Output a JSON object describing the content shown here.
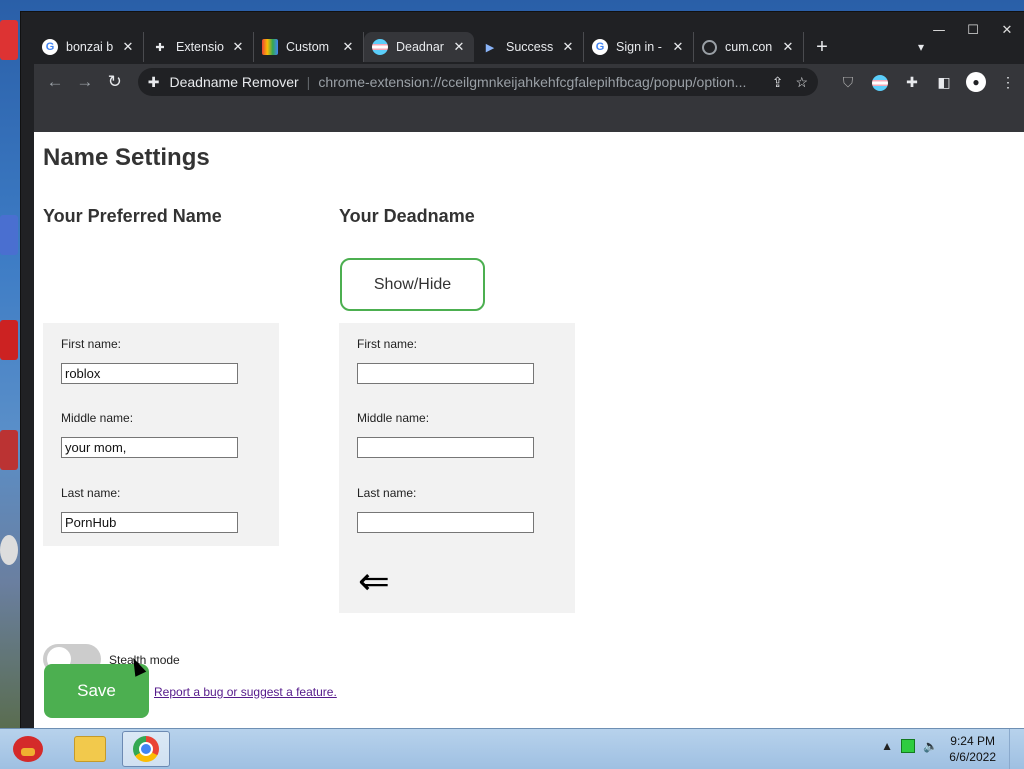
{
  "browser": {
    "tabs": [
      {
        "title": "bonzai b",
        "favicon": "google-icon",
        "active": false
      },
      {
        "title": "Extensio",
        "favicon": "puzzle-icon",
        "active": false
      },
      {
        "title": "Custom",
        "favicon": "store-icon",
        "active": false
      },
      {
        "title": "Deadnar",
        "favicon": "trans-flag-icon",
        "active": true
      },
      {
        "title": "Success",
        "favicon": "play-icon",
        "active": false
      },
      {
        "title": "Sign in -",
        "favicon": "google-icon",
        "active": false
      },
      {
        "title": "cum.con",
        "favicon": "globe-icon",
        "active": false
      }
    ],
    "site_name": "Deadname Remover",
    "url": "chrome-extension://cceilgmnkeijahkehfcgfalepihfbcag/popup/option...",
    "window_controls": {
      "minimize": "—",
      "maximize": "☐",
      "close": "✕"
    }
  },
  "page": {
    "title": "Name Settings",
    "preferred": {
      "heading": "Your Preferred Name",
      "first_label": "First name:",
      "first_value": "roblox",
      "middle_label": "Middle name:",
      "middle_value": "your mom,",
      "last_label": "Last name:",
      "last_value": "PornHub"
    },
    "deadname": {
      "heading": "Your Deadname",
      "show_hide": "Show/Hide",
      "first_label": "First name:",
      "first_value": "",
      "middle_label": "Middle name:",
      "middle_value": "",
      "last_label": "Last name:",
      "last_value": "",
      "arrow": "⇐"
    },
    "stealth_label": "Stealth mode",
    "stealth_on": false,
    "save_label": "Save",
    "report_link": "Report a bug or suggest a feature."
  },
  "taskbar": {
    "time": "9:24 PM",
    "date": "6/6/2022"
  },
  "colors": {
    "accent_green": "#4caf50",
    "browser_dark": "#202124",
    "toolbar": "#35363a"
  }
}
